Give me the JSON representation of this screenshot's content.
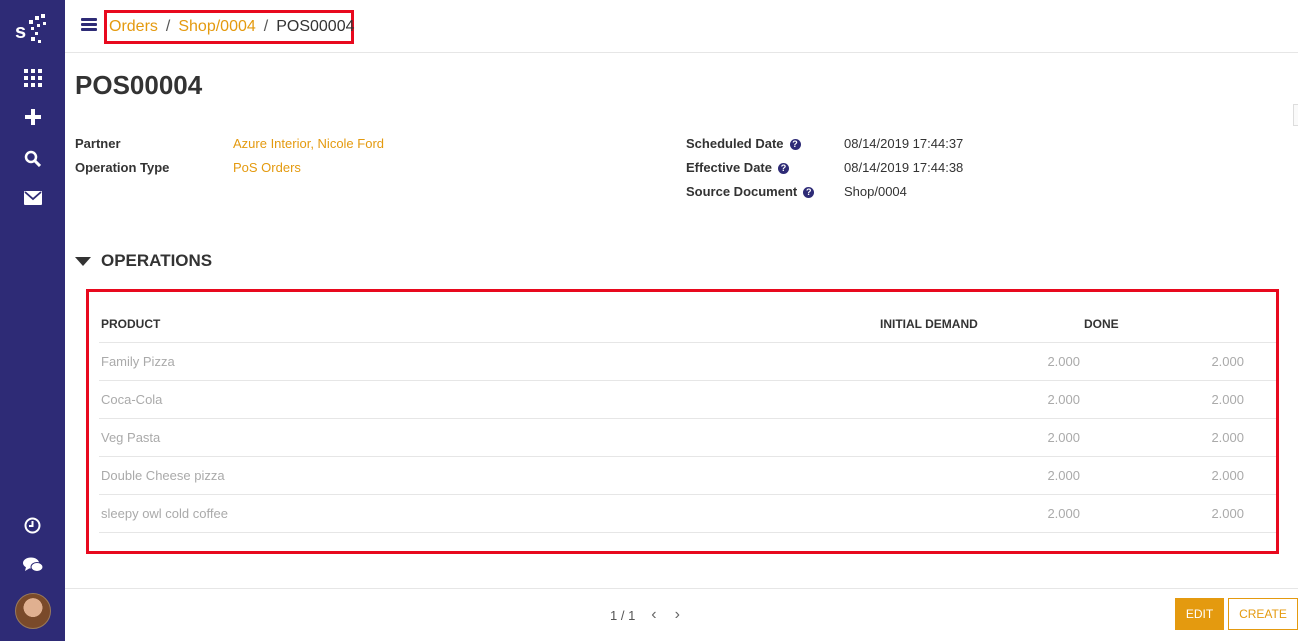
{
  "breadcrumb": {
    "items": [
      "Orders",
      "Shop/0004"
    ],
    "current": "POS00004",
    "separator": "/"
  },
  "title": "POS00004",
  "fields_left": [
    {
      "label": "Partner",
      "value": "Azure Interior, Nicole Ford"
    },
    {
      "label": "Operation Type",
      "value": "PoS Orders"
    }
  ],
  "fields_right": [
    {
      "label": "Scheduled Date",
      "value": "08/14/2019 17:44:37",
      "help": "?"
    },
    {
      "label": "Effective Date",
      "value": "08/14/2019 17:44:38",
      "help": "?"
    },
    {
      "label": "Source Document",
      "value": "Shop/0004",
      "help": "?"
    }
  ],
  "operations": {
    "section_title": "OPERATIONS",
    "columns": [
      "PRODUCT",
      "INITIAL DEMAND",
      "DONE"
    ],
    "rows": [
      {
        "product": "Family Pizza",
        "demand": "2.000",
        "done": "2.000"
      },
      {
        "product": "Coca-Cola",
        "demand": "2.000",
        "done": "2.000"
      },
      {
        "product": "Veg Pasta",
        "demand": "2.000",
        "done": "2.000"
      },
      {
        "product": "Double Cheese pizza",
        "demand": "2.000",
        "done": "2.000"
      },
      {
        "product": "sleepy owl cold coffee",
        "demand": "2.000",
        "done": "2.000"
      }
    ]
  },
  "footer": {
    "pager": "1 / 1",
    "edit_label": "EDIT",
    "create_label": "CREATE"
  },
  "colors": {
    "sidebar": "#2e2b76",
    "accent": "#e49a0f",
    "highlight": "#e8091e"
  }
}
